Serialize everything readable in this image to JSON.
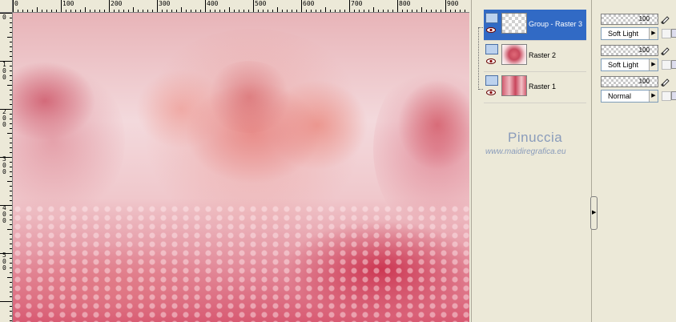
{
  "ruler": {
    "top_labels": [
      "0",
      "100",
      "200",
      "300",
      "400",
      "500",
      "600",
      "700",
      "800",
      "900"
    ],
    "left_labels": [
      "0",
      "1 0 0",
      "2 0 0",
      "3 0 0",
      "4 0 0",
      "5 0 0"
    ]
  },
  "layers": [
    {
      "name": "Group - Raster 3",
      "selected": true,
      "thumb": "transparent",
      "blend": "Soft Light",
      "opacity": "100"
    },
    {
      "name": "Raster 2",
      "selected": false,
      "thumb": "rose",
      "blend": "Soft Light",
      "opacity": "100"
    },
    {
      "name": "Raster 1",
      "selected": false,
      "thumb": "full",
      "blend": "Normal",
      "opacity": "100"
    }
  ],
  "watermark": {
    "name": "Pinuccia",
    "url": "www.maidiregrafica.eu"
  },
  "icons": {
    "layer": "layer-icon",
    "visibility": "eye-icon",
    "brush": "brush-icon",
    "lock": "lock-icon",
    "mask": "mask-icon",
    "collapse": "chevron-right-icon"
  },
  "colors": {
    "selection": "#316ac5",
    "panel": "#ece9d8",
    "watermark": "#8a9cbb"
  }
}
